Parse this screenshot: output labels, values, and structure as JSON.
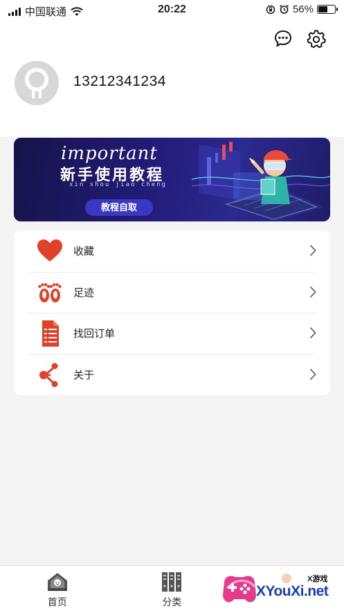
{
  "status_bar": {
    "carrier": "中国联通",
    "time": "20:22",
    "battery_text": "56%",
    "battery_level": 0.56
  },
  "header": {
    "icons": [
      "message-icon",
      "gear-icon"
    ],
    "phone": "13212341234"
  },
  "banner": {
    "title_en": "important",
    "title": "新手使用教程",
    "pinyin": "xin shou jiao cheng",
    "button": "教程自取"
  },
  "menu": {
    "items": [
      {
        "label": "收藏",
        "icon": "heart-icon"
      },
      {
        "label": "足迹",
        "icon": "footprints-icon"
      },
      {
        "label": "找回订单",
        "icon": "document-icon"
      },
      {
        "label": "关于",
        "icon": "share-icon"
      }
    ]
  },
  "tabbar": {
    "tabs": [
      {
        "label": "首页",
        "icon": "home-icon"
      },
      {
        "label": "分类",
        "icon": "category-icon"
      }
    ]
  },
  "watermark": {
    "brand": "XYouXi.net",
    "sub": "X游戏"
  },
  "colors": {
    "accent_red": "#e0412b",
    "banner_bg": "#231c7a",
    "banner_button": "#3a37c4"
  }
}
